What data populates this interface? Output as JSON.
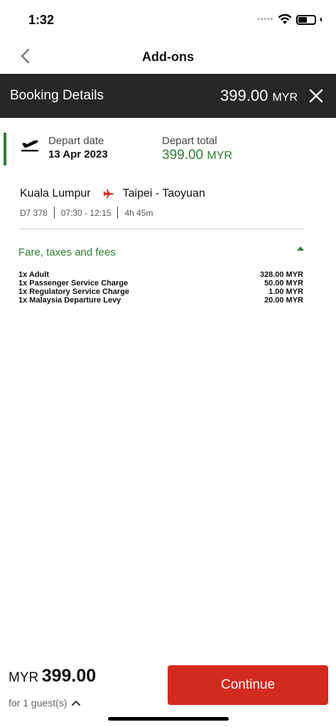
{
  "status_bar": {
    "time": "1:32",
    "signal": "•••••",
    "battery_level": 0.55
  },
  "nav": {
    "title": "Add-ons",
    "back_icon": "chevron-left-icon"
  },
  "booking_bar": {
    "title": "Booking Details",
    "amount": "399.00",
    "currency": "MYR",
    "close_icon": "close-icon"
  },
  "depart": {
    "icon": "flight-takeoff-icon",
    "date_label": "Depart date",
    "date_value": "13 Apr 2023",
    "total_label": "Depart total",
    "total_amount": "399.00",
    "total_currency": "MYR"
  },
  "route": {
    "origin": "Kuala Lumpur",
    "destination": "Taipei - Taoyuan",
    "flight_no": "D7 378",
    "times": "07:30 - 12:15",
    "duration": "4h 45m"
  },
  "fees": {
    "title": "Fare, taxes and fees",
    "items": [
      {
        "label": "1x Adult",
        "amount": "328.00 MYR"
      },
      {
        "label": "1x Passenger Service Charge",
        "amount": "50.00 MYR"
      },
      {
        "label": "1x Regulatory Service Charge",
        "amount": "1.00 MYR"
      },
      {
        "label": "1x Malaysia Departure Levy",
        "amount": "20.00 MYR"
      }
    ]
  },
  "footer": {
    "currency": "MYR",
    "amount": "399.00",
    "guests": "for 1 guest(s)",
    "continue_label": "Continue"
  },
  "colors": {
    "accent_green": "#2e7d32",
    "brand_red": "#d32a1f",
    "dark_bar": "#272727"
  }
}
